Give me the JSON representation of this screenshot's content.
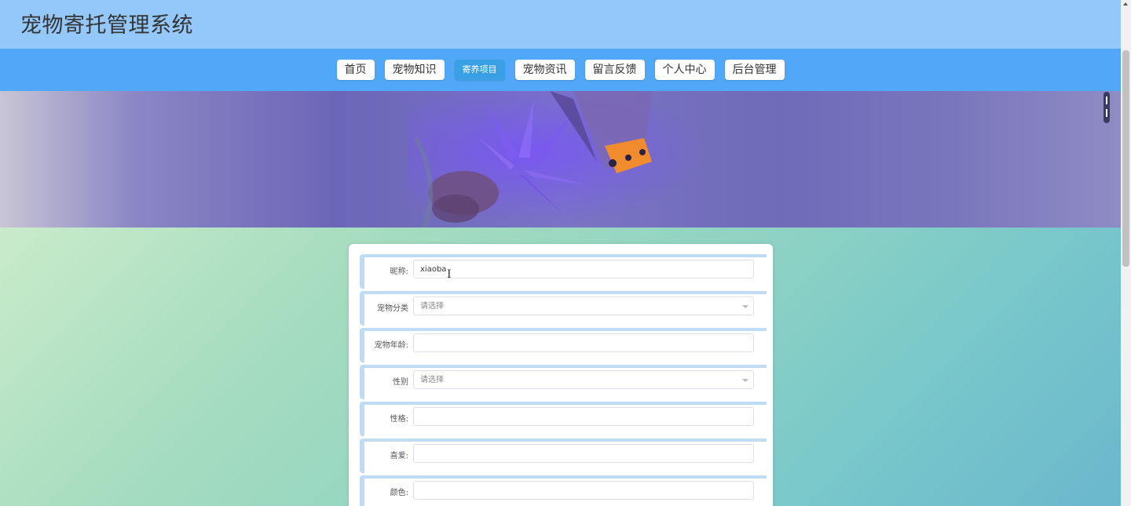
{
  "header": {
    "title": "宠物寄托管理系统"
  },
  "nav": {
    "items": [
      {
        "label": "首页"
      },
      {
        "label": "宠物知识"
      },
      {
        "label": "寄养项目"
      },
      {
        "label": "宠物资讯"
      },
      {
        "label": "留言反馈"
      },
      {
        "label": "个人中心"
      },
      {
        "label": "后台管理"
      }
    ],
    "active_index": 2
  },
  "form": {
    "fields": [
      {
        "label": "昵称:",
        "value": "xiaoba",
        "type": "text"
      },
      {
        "label": "宠物分类",
        "placeholder": "请选择",
        "type": "select"
      },
      {
        "label": "宠物年龄:",
        "value": "",
        "type": "text"
      },
      {
        "label": "性别",
        "placeholder": "请选择",
        "type": "select"
      },
      {
        "label": "性格:",
        "value": "",
        "type": "text"
      },
      {
        "label": "喜爱:",
        "value": "",
        "type": "text"
      },
      {
        "label": "颜色:",
        "value": "",
        "type": "text"
      }
    ]
  },
  "colors": {
    "header_bg": "#94c8fb",
    "nav_bg": "#52a8f8",
    "active_nav": "#3aa0e6",
    "row_accent": "#bfdcf7"
  },
  "icons": {
    "select_arrow": "chevron-down-icon",
    "text_cursor": "i-beam-cursor-icon"
  }
}
